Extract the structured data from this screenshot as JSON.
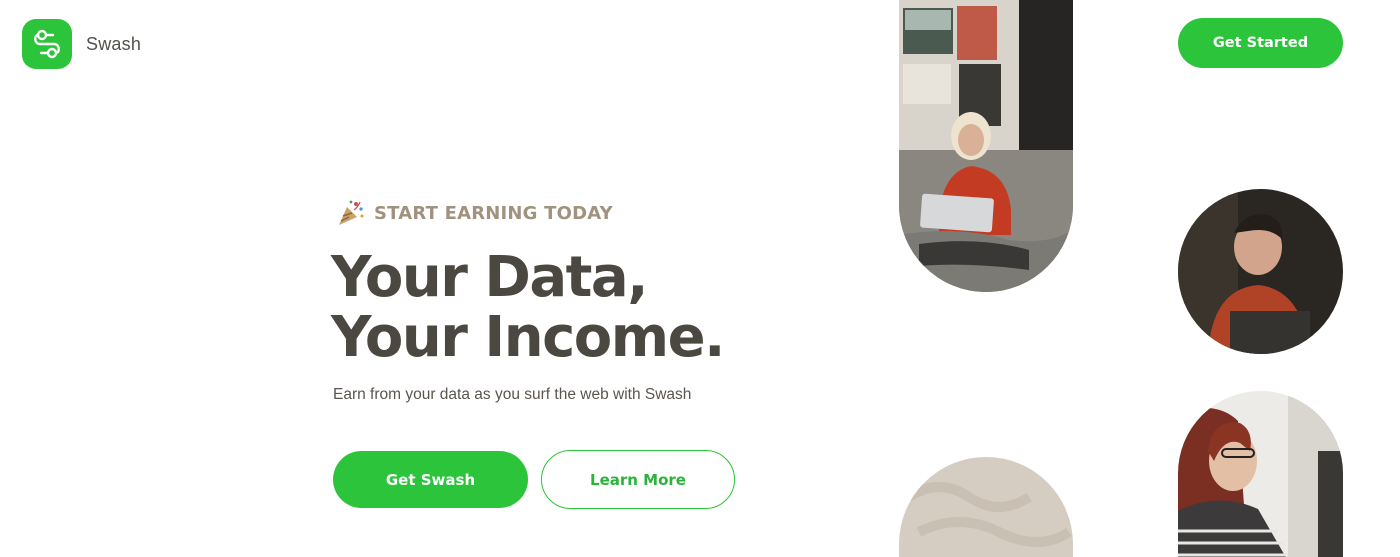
{
  "brand": {
    "name": "Swash",
    "logo_icon": "swash-logo-icon",
    "accent_color": "#2bc43a"
  },
  "header": {
    "cta_label": "Get Started"
  },
  "hero": {
    "eyebrow_icon": "party-popper-icon",
    "eyebrow": "START EARNING TODAY",
    "headline_line1": "Your Data,",
    "headline_line2": "Your Income.",
    "subtitle": "Earn from your data as you surf the web with Swash",
    "primary_button": "Get Swash",
    "secondary_button": "Learn More"
  }
}
